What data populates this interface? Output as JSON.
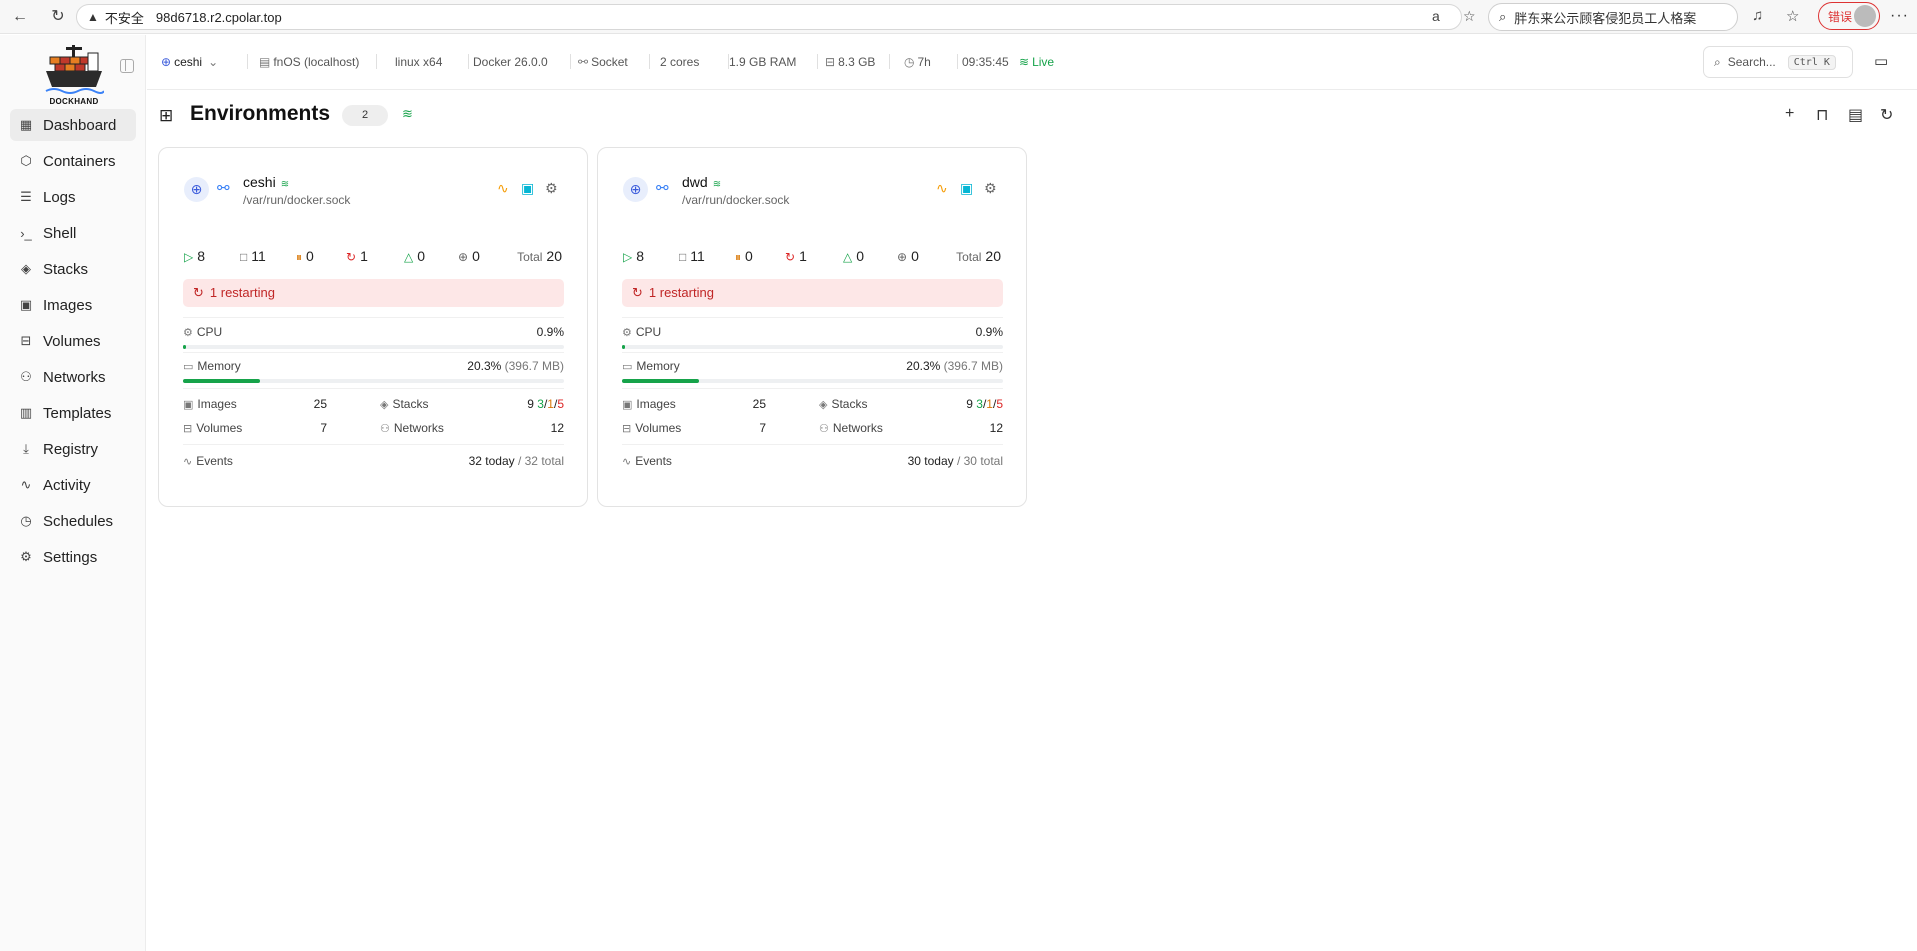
{
  "browser": {
    "insecure_label": "不安全",
    "url": "98d6718.r2.cpolar.top",
    "search_text": "胖东来公示顾客侵犯员工人格案",
    "error_label": "错误"
  },
  "sidebar": {
    "logo_text": "DOCKHAND",
    "items": [
      {
        "label": "Dashboard",
        "icon": "dashboard-icon",
        "glyph": "▦"
      },
      {
        "label": "Containers",
        "icon": "box-icon",
        "glyph": "⬡"
      },
      {
        "label": "Logs",
        "icon": "logs-icon",
        "glyph": "☰"
      },
      {
        "label": "Shell",
        "icon": "terminal-icon",
        "glyph": "›_"
      },
      {
        "label": "Stacks",
        "icon": "layers-icon",
        "glyph": "◈"
      },
      {
        "label": "Images",
        "icon": "images-icon",
        "glyph": "▣"
      },
      {
        "label": "Volumes",
        "icon": "disk-icon",
        "glyph": "⊟"
      },
      {
        "label": "Networks",
        "icon": "network-icon",
        "glyph": "⚇"
      },
      {
        "label": "Templates",
        "icon": "library-icon",
        "glyph": "▥"
      },
      {
        "label": "Registry",
        "icon": "download-icon",
        "glyph": "⤓"
      },
      {
        "label": "Activity",
        "icon": "activity-icon",
        "glyph": "∿"
      },
      {
        "label": "Schedules",
        "icon": "timer-icon",
        "glyph": "◷"
      },
      {
        "label": "Settings",
        "icon": "gear-icon",
        "glyph": "⚙"
      }
    ]
  },
  "topbar": {
    "env": "ceshi",
    "host": "fnOS (localhost)",
    "platform": "linux x64",
    "docker": "Docker 26.0.0",
    "connection": "Socket",
    "cores": "2 cores",
    "ram": "1.9 GB RAM",
    "disk": "8.3 GB",
    "uptime": "7h",
    "time": "09:35:45",
    "live": "Live",
    "search_placeholder": "Search...",
    "search_shortcut": "Ctrl K"
  },
  "page": {
    "title": "Environments",
    "count": "2"
  },
  "cards": [
    {
      "name": "ceshi",
      "path": "/var/run/docker.sock",
      "running": "8",
      "stopped": "11",
      "paused": "0",
      "restarting": "1",
      "unhealthy": "0",
      "created": "0",
      "total_label": "Total",
      "total": "20",
      "restart_text": "1 restarting",
      "cpu_label": "CPU",
      "cpu_value": "0.9%",
      "cpu_fraction": 0.009,
      "mem_label": "Memory",
      "mem_value": "20.3%",
      "mem_detail": "(396.7 MB)",
      "mem_fraction": 0.203,
      "images_label": "Images",
      "images": "25",
      "stacks_label": "Stacks",
      "stacks_total": "9",
      "stacks_running": "3",
      "stacks_partial": "1",
      "stacks_stopped": "5",
      "volumes_label": "Volumes",
      "volumes": "7",
      "networks_label": "Networks",
      "networks": "12",
      "events_label": "Events",
      "events_today": "32 today",
      "events_total": "/ 32 total"
    },
    {
      "name": "dwd",
      "path": "/var/run/docker.sock",
      "running": "8",
      "stopped": "11",
      "paused": "0",
      "restarting": "1",
      "unhealthy": "0",
      "created": "0",
      "total_label": "Total",
      "total": "20",
      "restart_text": "1 restarting",
      "cpu_label": "CPU",
      "cpu_value": "0.9%",
      "cpu_fraction": 0.009,
      "mem_label": "Memory",
      "mem_value": "20.3%",
      "mem_detail": "(396.7 MB)",
      "mem_fraction": 0.203,
      "images_label": "Images",
      "images": "25",
      "stacks_label": "Stacks",
      "stacks_total": "9",
      "stacks_running": "3",
      "stacks_partial": "1",
      "stacks_stopped": "5",
      "volumes_label": "Volumes",
      "volumes": "7",
      "networks_label": "Networks",
      "networks": "12",
      "events_label": "Events",
      "events_today": "30 today",
      "events_total": "/ 30 total"
    }
  ],
  "colors": {
    "accent_green": "#16a34a",
    "restart_red": "#dc2626",
    "pause_orange": "#d97706"
  }
}
